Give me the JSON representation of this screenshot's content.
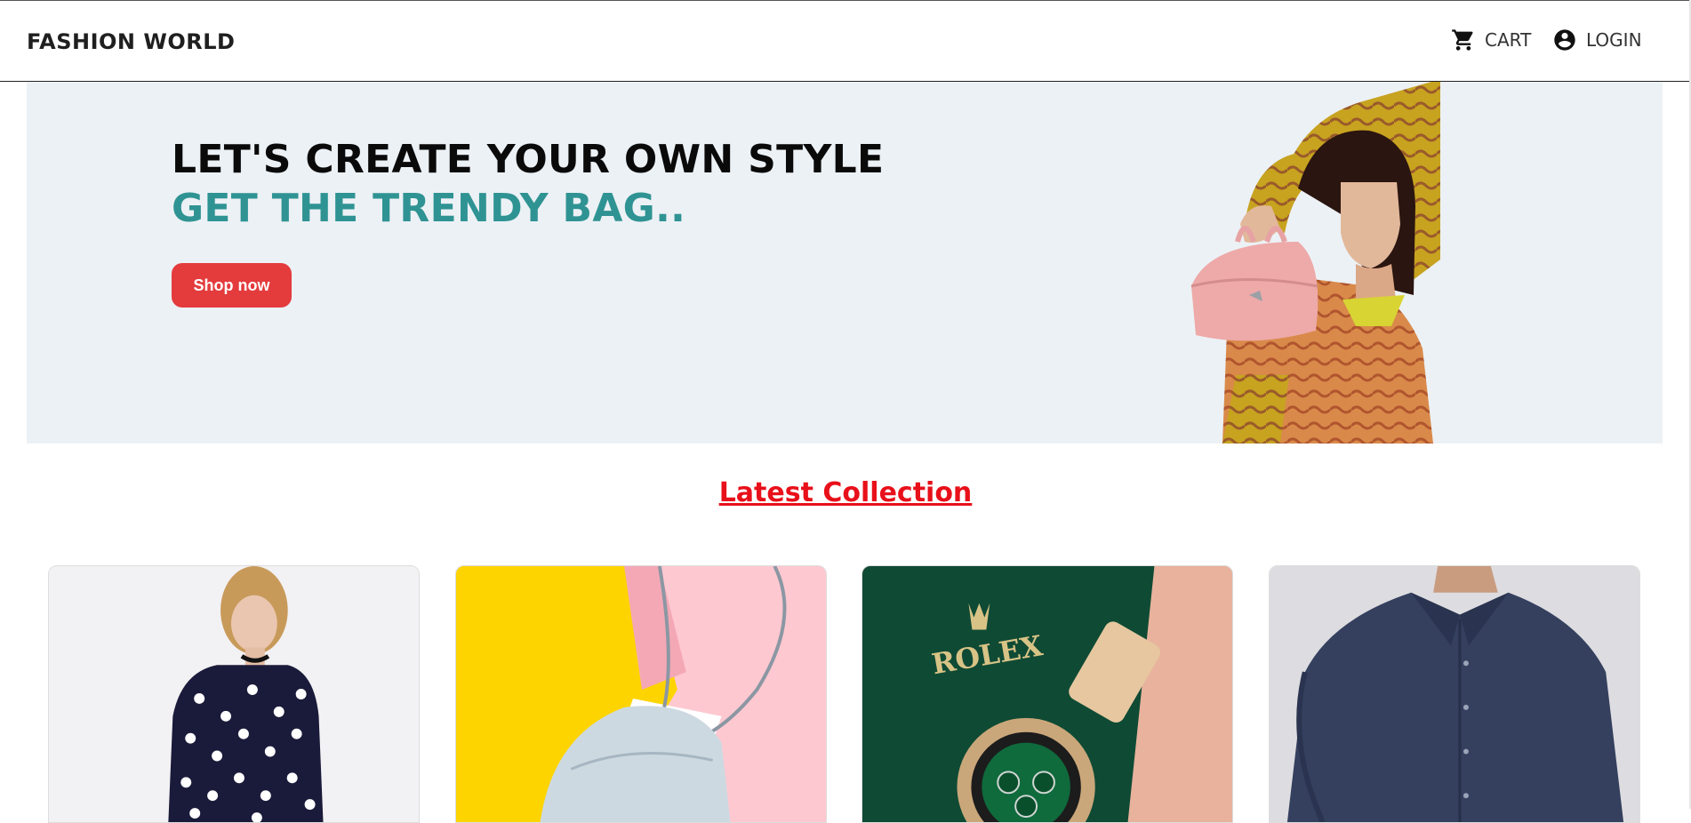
{
  "navbar": {
    "brand": "FASHION WORLD",
    "cart_label": "CART",
    "login_label": "LOGIN",
    "cart_icon": "cart-icon",
    "login_icon": "account-circle-icon"
  },
  "hero": {
    "title": "LET'S CREATE YOUR OWN STYLE",
    "subtitle": "GET THE TRENDY BAG..",
    "button_label": "Shop now",
    "background_color": "#ecf1f5",
    "subtitle_color": "#2f9393",
    "button_color": "#e43b3d"
  },
  "collection": {
    "title": "Latest Collection",
    "title_color": "#e8101a",
    "products": [
      {
        "name": "polka-dot-dress"
      },
      {
        "name": "pastel-handbag"
      },
      {
        "name": "rolex-watch"
      },
      {
        "name": "navy-shirt"
      }
    ]
  }
}
